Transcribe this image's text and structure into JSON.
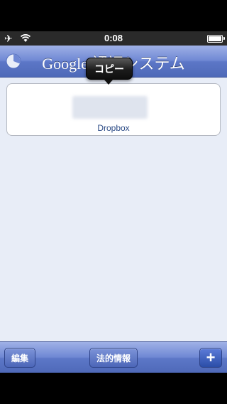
{
  "status": {
    "time": "0:08"
  },
  "nav": {
    "title": "Google 認証システム"
  },
  "tooltip": {
    "label": "コピー"
  },
  "account": {
    "label": "Dropbox"
  },
  "toolbar": {
    "edit_label": "編集",
    "legal_label": "法的情報",
    "add_label": "+"
  },
  "icons": {
    "airplane": "airplane-icon",
    "wifi": "wifi-icon",
    "battery": "battery-icon",
    "clock": "countdown-clock-icon",
    "add": "plus-icon"
  },
  "colors": {
    "nav": "#5c77c7",
    "content_bg": "#e8edf7",
    "label": "#2c4b86"
  }
}
